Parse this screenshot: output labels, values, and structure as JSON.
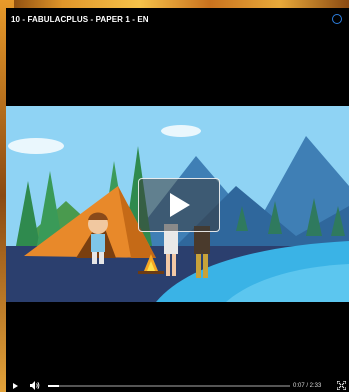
{
  "player": {
    "title": "10 - FABULACPLUS - PAPER 1 - EN",
    "time": "0:07 / 2:33",
    "progress": 0.046
  },
  "icons": {
    "status": "spinner-icon",
    "play": "play-icon",
    "volume": "volume-icon",
    "fullscreen": "fullscreen-icon",
    "big_play": "play-overlay-icon"
  },
  "colors": {
    "player_bg": "#000000",
    "accent": "#2d7fe0",
    "sky": "#8fd3f4",
    "water": "#3ab3e6",
    "tent": "#e8892a"
  }
}
